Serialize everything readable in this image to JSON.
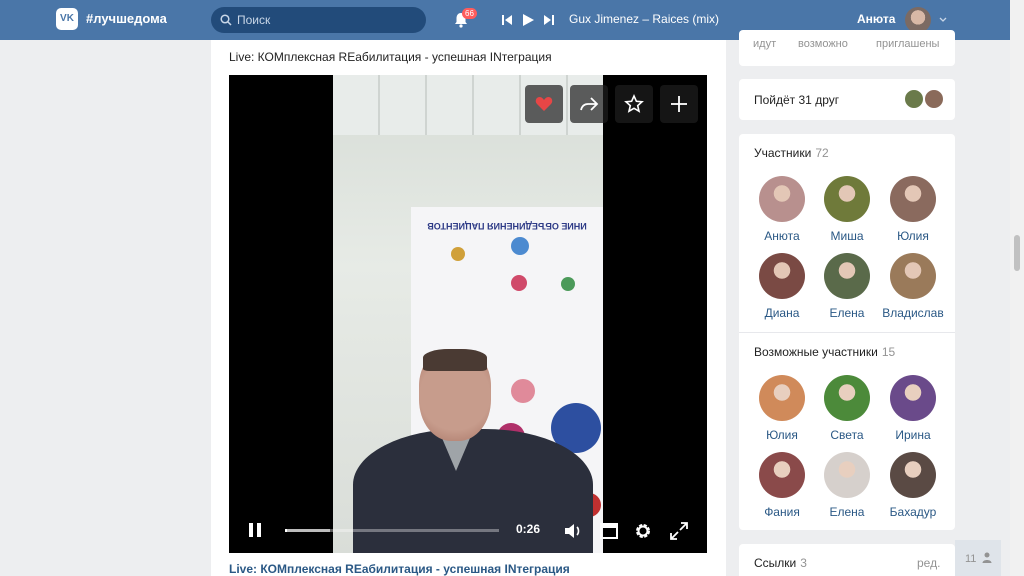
{
  "header": {
    "logo_text": "VK",
    "site_title": "#лучшедома",
    "search_placeholder": "Поиск",
    "notifications_count": "66",
    "track": "Gux Jimenez – Raices (mix)",
    "user_name": "Анюта"
  },
  "post": {
    "title": "Live: КОМплексная REабилитация - успешная INтеграция",
    "link_title": "Live: КОМплексная REабилитация - успешная INтеграция",
    "banner_text": "ИНИЕ ОБЪЕДИНЕНИЯ ПАЦИЕНТОВ",
    "time": "0:26",
    "progress_percent": 1,
    "buffer_percent": 21
  },
  "sidebar": {
    "stats": [
      "идут",
      "возможно",
      "приглашены"
    ],
    "friends_going": "Пойдёт 31 друг",
    "members": {
      "title": "Участники",
      "count": "72",
      "items": [
        {
          "name": "Анюта",
          "color": "#b8908e"
        },
        {
          "name": "Миша",
          "color": "#6f7a3a"
        },
        {
          "name": "Юлия",
          "color": "#8a6a5e"
        },
        {
          "name": "Диана",
          "color": "#7a4a44"
        },
        {
          "name": "Елена",
          "color": "#5a6a4a"
        },
        {
          "name": "Владислав",
          "color": "#9a7a5a"
        }
      ]
    },
    "possible": {
      "title": "Возможные участники",
      "count": "15",
      "items": [
        {
          "name": "Юлия",
          "color": "#d08a5a"
        },
        {
          "name": "Света",
          "color": "#4c8a3a"
        },
        {
          "name": "Ирина",
          "color": "#6a4a8a"
        },
        {
          "name": "Фания",
          "color": "#8a4a4a"
        },
        {
          "name": "Елена",
          "color": "#d6d0cc"
        },
        {
          "name": "Бахадур",
          "color": "#5a4a44"
        }
      ]
    },
    "links": {
      "title": "Ссылки",
      "count": "3",
      "edit": "ред."
    },
    "online_count": "11"
  }
}
